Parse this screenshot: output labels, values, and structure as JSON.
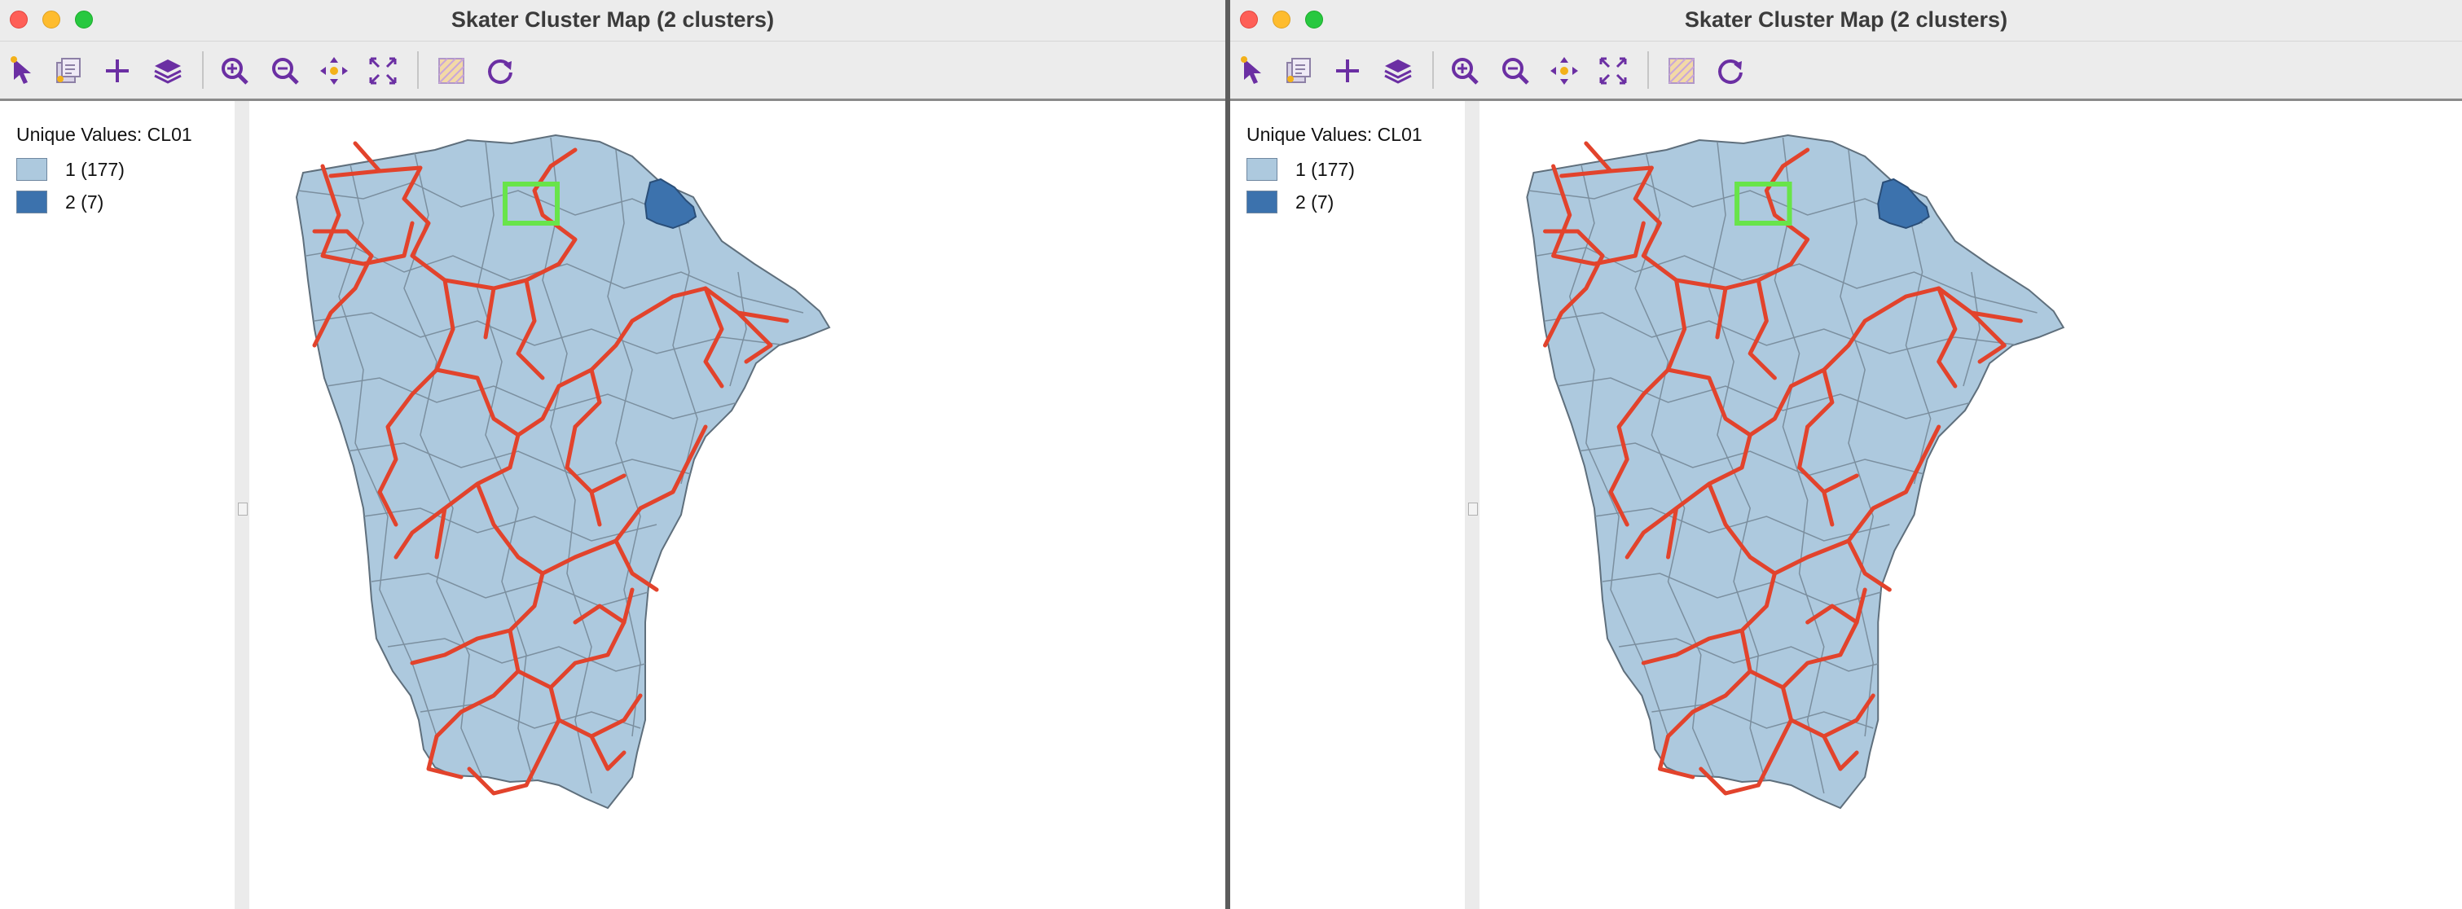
{
  "windows": [
    {
      "title": "Skater Cluster Map (2 clusters)",
      "legend": {
        "title": "Unique Values: CL01",
        "items": [
          {
            "label": "1 (177)",
            "color": "#adc9de"
          },
          {
            "label": "2 (7)",
            "color": "#3c72ad"
          }
        ]
      }
    },
    {
      "title": "Skater Cluster Map (2 clusters)",
      "legend": {
        "title": "Unique Values: CL01",
        "items": [
          {
            "label": "1 (177)",
            "color": "#adc9de"
          },
          {
            "label": "2 (7)",
            "color": "#3c72ad"
          }
        ]
      }
    }
  ],
  "toolbar_icons": [
    "select-icon",
    "layer-select-icon",
    "add-icon",
    "layers-icon",
    "zoom-in-icon",
    "zoom-out-icon",
    "pan-icon",
    "fit-extent-icon",
    "basemap-icon",
    "refresh-icon"
  ],
  "colors": {
    "cluster_1": "#adc9de",
    "cluster_2": "#3c72ad",
    "tree_edges": "#e2432c",
    "selection_box": "#68e44a",
    "icon_purple": "#6b2fa3"
  }
}
